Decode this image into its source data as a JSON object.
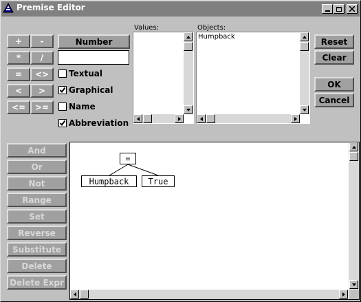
{
  "window": {
    "title": "Premise Editor"
  },
  "operators": [
    "+",
    "-",
    "*",
    "/",
    "=",
    "<>",
    "<",
    ">",
    "<=",
    ">="
  ],
  "number_button": "Number",
  "number_input": "",
  "checkboxes": [
    {
      "label": "Textual",
      "checked": false
    },
    {
      "label": "Graphical",
      "checked": true
    },
    {
      "label": "Name",
      "checked": false
    },
    {
      "label": "Abbreviation",
      "checked": true
    }
  ],
  "values": {
    "label": "Values:",
    "items": []
  },
  "objects": {
    "label": "Objects:",
    "items": [
      "Humpback"
    ]
  },
  "actions": {
    "reset": "Reset",
    "clear": "Clear",
    "ok": "OK",
    "cancel": "Cancel"
  },
  "logic_buttons": [
    "And",
    "Or",
    "Not",
    "Range",
    "Set",
    "Reverse",
    "Substitute",
    "Delete",
    "Delete Expr"
  ],
  "expression": {
    "operator": "=",
    "left": "Humpback",
    "right": "True"
  }
}
